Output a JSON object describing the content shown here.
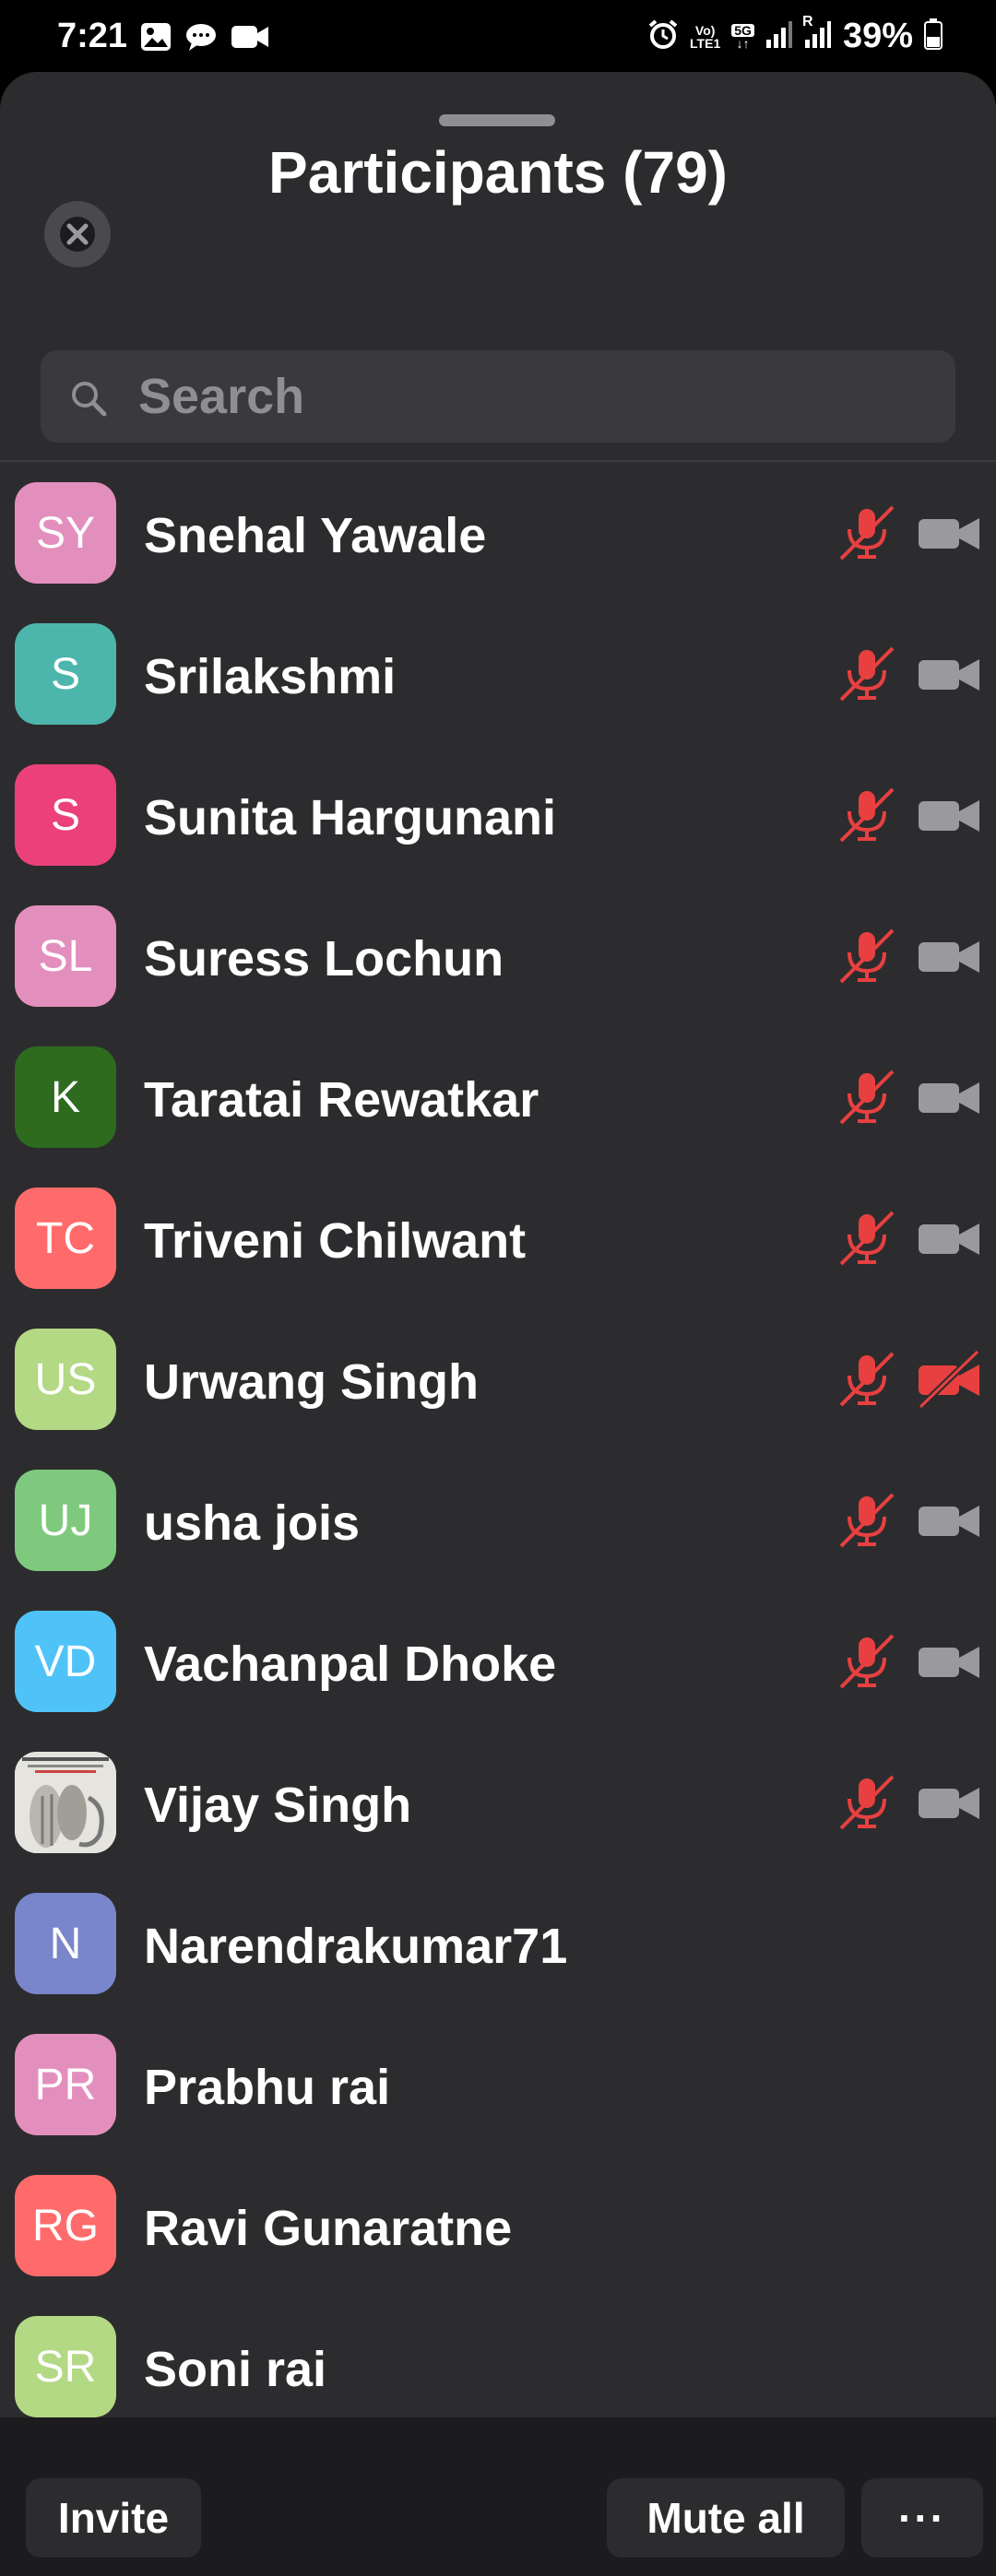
{
  "status_bar": {
    "time": "7:21",
    "battery": "39%",
    "net_top": "Vo)",
    "net_bottom": "LTE1",
    "fiveg": "5G",
    "roaming": "R"
  },
  "sheet": {
    "title": "Participants (79)",
    "search_placeholder": "Search"
  },
  "participants": [
    {
      "initials": "SY",
      "name": "Snehal Yawale",
      "color": "#e38fbd",
      "mic": "muted",
      "video": "off"
    },
    {
      "initials": "S",
      "name": "Srilakshmi",
      "color": "#4db6ac",
      "mic": "muted",
      "video": "off"
    },
    {
      "initials": "S",
      "name": "Sunita Hargunani",
      "color": "#ec407a",
      "mic": "muted",
      "video": "off"
    },
    {
      "initials": "SL",
      "name": "Suress Lochun",
      "color": "#e38fbd",
      "mic": "muted",
      "video": "off"
    },
    {
      "initials": "K",
      "name": "Taratai Rewatkar",
      "color": "#2e6b1f",
      "mic": "muted",
      "video": "off"
    },
    {
      "initials": "TC",
      "name": "Triveni Chilwant",
      "color": "#ff6b6b",
      "mic": "muted",
      "video": "off"
    },
    {
      "initials": "US",
      "name": "Urwang Singh",
      "color": "#b3d984",
      "mic": "muted",
      "video": "off-red"
    },
    {
      "initials": "UJ",
      "name": "usha jois",
      "color": "#7fc97f",
      "mic": "muted",
      "video": "off"
    },
    {
      "initials": "VD",
      "name": "Vachanpal Dhoke",
      "color": "#4fc3f7",
      "mic": "muted",
      "video": "off"
    },
    {
      "initials": "",
      "name": "Vijay Singh",
      "color": "#d9d9d9",
      "photo": true,
      "mic": "muted",
      "video": "off"
    },
    {
      "initials": "N",
      "name": "Narendrakumar71",
      "color": "#7986cb",
      "mic": "none",
      "video": "none"
    },
    {
      "initials": "PR",
      "name": "Prabhu rai",
      "color": "#e38fbd",
      "mic": "none",
      "video": "none"
    },
    {
      "initials": "RG",
      "name": "Ravi Gunaratne",
      "color": "#ff6b6b",
      "mic": "none",
      "video": "none"
    },
    {
      "initials": "SR",
      "name": "Soni rai",
      "color": "#b3d984",
      "mic": "none",
      "video": "none"
    }
  ],
  "icons": {
    "mic_muted": "mic-muted-icon",
    "video_off": "video-off-icon",
    "close": "close-icon",
    "search": "search-icon"
  },
  "colors": {
    "muted_red": "#e84040",
    "video_gray": "#9a9a9e",
    "sheet_bg": "#2c2c2e"
  },
  "bottom_bar": {
    "invite": "Invite",
    "mute_all": "Mute all",
    "more": "···"
  }
}
